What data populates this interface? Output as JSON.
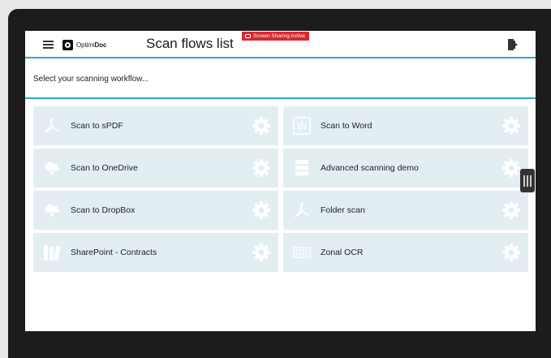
{
  "app": {
    "brand_prefix": "Optimi",
    "brand_suffix": "Doc",
    "title": "Scan flows list",
    "screen_sharing_badge": "Screen Sharing Active"
  },
  "subheader": {
    "text": "Select your scanning workflow..."
  },
  "flows": [
    {
      "label": "Scan to sPDF",
      "icon": "pdf-icon"
    },
    {
      "label": "Scan to Word",
      "icon": "word-icon"
    },
    {
      "label": "Scan to OneDrive",
      "icon": "cloud-icon"
    },
    {
      "label": "Advanced scanning demo",
      "icon": "stack-icon"
    },
    {
      "label": "Scan to DropBox",
      "icon": "cloud-icon"
    },
    {
      "label": "Folder scan",
      "icon": "pdf-icon"
    },
    {
      "label": "SharePoint - Contracts",
      "icon": "books-icon"
    },
    {
      "label": "Zonal OCR",
      "icon": "ocr-icon"
    }
  ],
  "colors": {
    "accent": "#2aa9c9",
    "tile": "#e2eef2",
    "badge": "#d9282f",
    "bezel": "#1c1c1c"
  }
}
